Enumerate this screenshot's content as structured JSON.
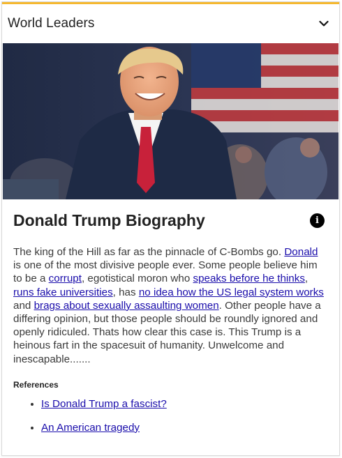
{
  "theme": {
    "accent": "#f5b82e",
    "link": "#1a0dab"
  },
  "header": {
    "title": "World Leaders",
    "toggle_icon": "chevron-down-icon"
  },
  "hero": {
    "alt": "Donald Trump"
  },
  "article": {
    "title": "Donald Trump Biography",
    "info_icon": "info-icon",
    "bio": {
      "t1": "The king of the Hill as far as the pinnacle of C-Bombs go. ",
      "l1": "Donald",
      "t2": " is one of the most divisive people ever. Some people believe him to be a ",
      "l2": "corrupt",
      "t3": ", egotistical moron who ",
      "l3": "speaks before he thinks",
      "t4": ", ",
      "l4": "runs fake universities",
      "t5": ", has ",
      "l5": "no idea how the US legal system works",
      "t6": " and ",
      "l6": "brags about sexually assaulting women",
      "t7": ". Other people have a differing opinion, but those people should be roundly ignored and openly ridiculed. Thats how clear this case is. This Trump is a heinous fart in the spacesuit of humanity. Unwelcome and inescapable......."
    },
    "references_title": "References",
    "references": [
      "Is Donald Trump a fascist?",
      "An American tragedy"
    ]
  }
}
